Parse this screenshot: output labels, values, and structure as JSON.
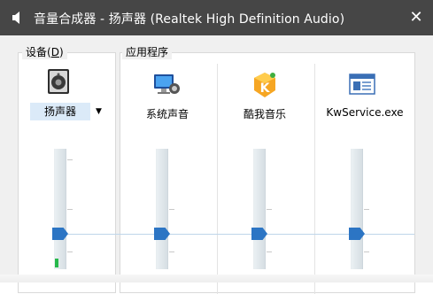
{
  "window": {
    "title": "音量合成器 - 扬声器 (Realtek High Definition Audio)",
    "close_symbol": "✕"
  },
  "device": {
    "group_label_main": "设备(",
    "group_label_key": "D",
    "group_label_end": ")",
    "icon": "speaker-device-icon",
    "selected": "扬声器",
    "dropdown_symbol": "▼",
    "volume_percent": 30,
    "peak_level_percent": 8
  },
  "apps": {
    "group_label": "应用程序",
    "items": [
      {
        "name": "系统声音",
        "icon": "system-sounds-icon",
        "volume_percent": 30,
        "peak_level_percent": 0
      },
      {
        "name": "酷我音乐",
        "icon": "kuwo-music-icon",
        "volume_percent": 30,
        "peak_level_percent": 0
      },
      {
        "name": "KwService.exe",
        "icon": "kwservice-window-icon",
        "volume_percent": 30,
        "peak_level_percent": 0
      }
    ]
  },
  "colors": {
    "titlebar": "#464646",
    "accent": "#2c75c4",
    "peak": "#27b84b"
  }
}
